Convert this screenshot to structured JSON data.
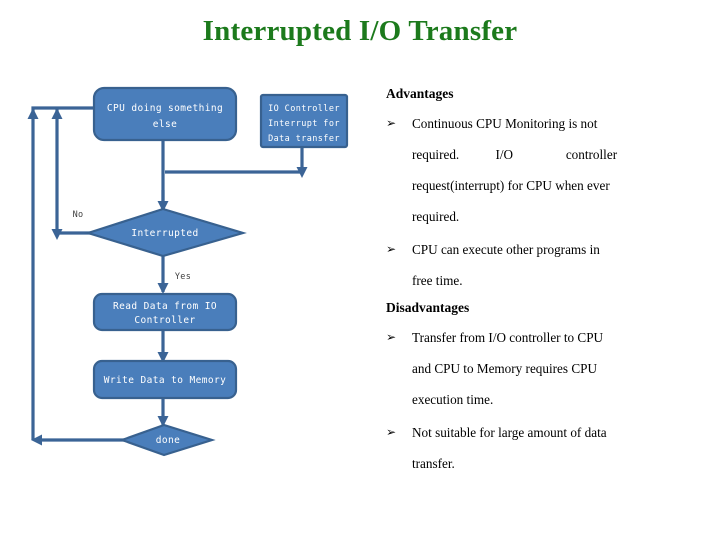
{
  "slide": {
    "title": "Interrupted I/O Transfer",
    "title_color": "#1c7a1c",
    "background": "#ffffff"
  },
  "theme": {
    "node_fill": "#4a7ebb",
    "node_stroke": "#38618f",
    "connector_color": "#3b6496",
    "node_text_color": "#ffffff",
    "edge_label_color": "#3f3f3f",
    "body_text_color": "#000000"
  },
  "flowchart": {
    "nodes": [
      {
        "id": "cpu",
        "shape": "rounded-rect",
        "lines": [
          "CPU doing something",
          "else"
        ]
      },
      {
        "id": "io",
        "shape": "rect",
        "lines": [
          "IO Controller",
          "Interrupt for",
          "Data transfer"
        ]
      },
      {
        "id": "decision",
        "shape": "diamond",
        "lines": [
          "Interrupted"
        ]
      },
      {
        "id": "read",
        "shape": "rounded-rect",
        "lines": [
          "Read Data from IO",
          "Controller"
        ]
      },
      {
        "id": "write",
        "shape": "rounded-rect",
        "lines": [
          "Write Data to Memory"
        ]
      },
      {
        "id": "done",
        "shape": "diamond",
        "lines": [
          "done"
        ]
      }
    ],
    "edge_labels": {
      "no": "No",
      "yes": "Yes"
    }
  },
  "text_panel": {
    "advantages": {
      "heading": "Advantages",
      "bullets": [
        {
          "marker": "➢",
          "lines": [
            "Continuous  CPU  Monitoring  is  not",
            "required.           I/O                controller",
            "request(interrupt) for CPU when ever",
            "required."
          ]
        },
        {
          "marker": "➢",
          "lines": [
            "CPU  can  execute  other  programs  in",
            "free time."
          ]
        }
      ]
    },
    "disadvantages": {
      "heading": "Disadvantages",
      "bullets": [
        {
          "marker": "➢",
          "lines": [
            "Transfer  from I/O  controller  to  CPU",
            "and  CPU  to  Memory  requires  CPU",
            "execution time."
          ]
        },
        {
          "marker": "➢",
          "lines": [
            "Not  suitable  for  large  amount  of  data",
            "transfer."
          ]
        }
      ]
    }
  }
}
